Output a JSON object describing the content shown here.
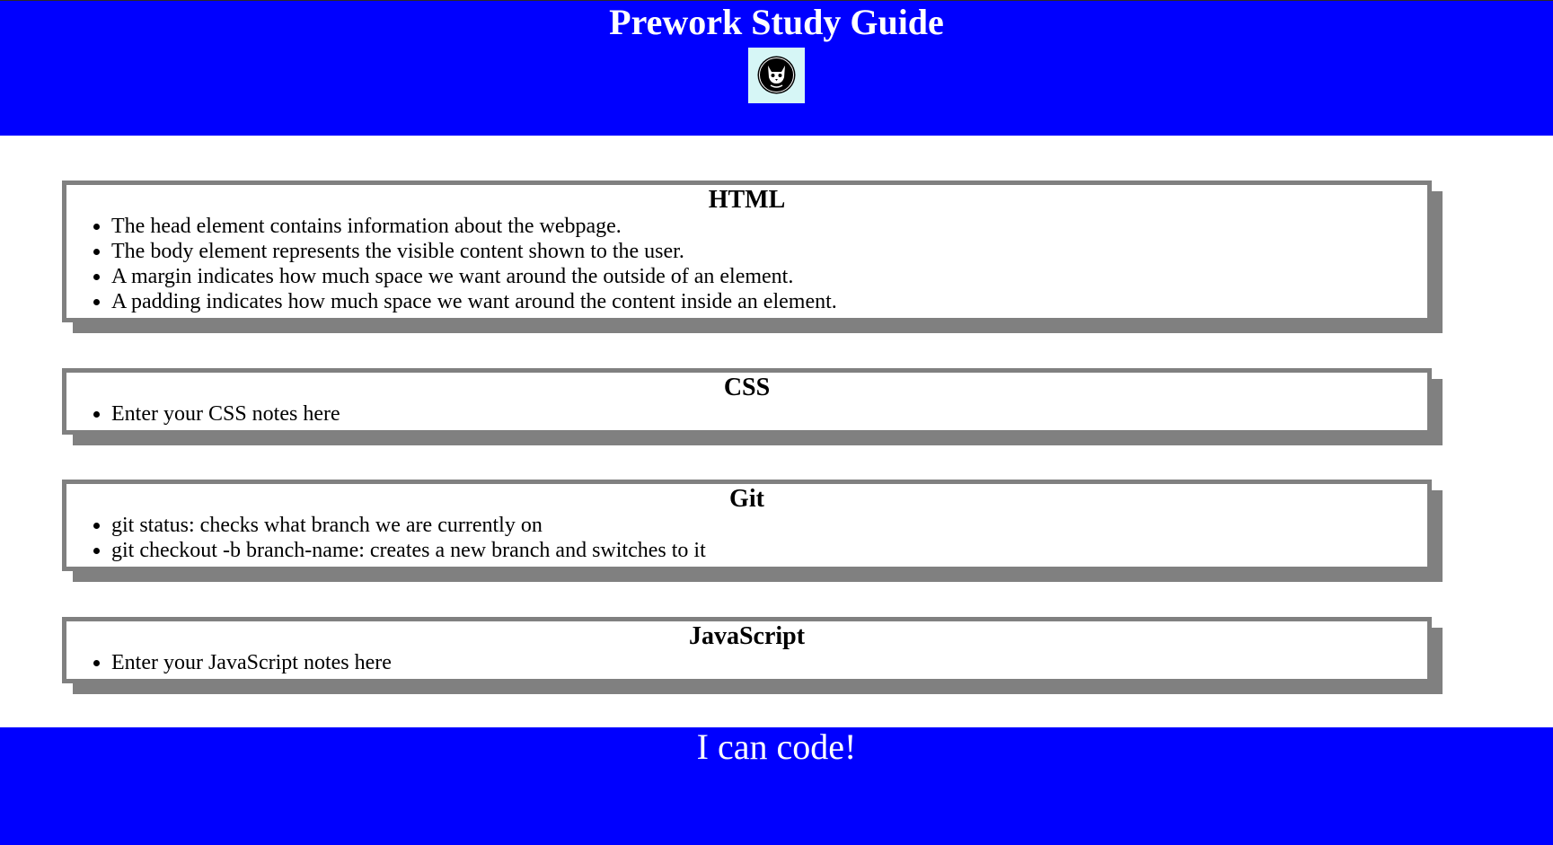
{
  "header": {
    "title": "Prework Study Guide",
    "logo_icon": "cat-face-icon"
  },
  "sections": [
    {
      "title": "HTML",
      "items": [
        "The head element contains information about the webpage.",
        "The body element represents the visible content shown to the user.",
        "A margin indicates how much space we want around the outside of an element.",
        "A padding indicates how much space we want around the content inside an element."
      ]
    },
    {
      "title": "CSS",
      "items": [
        "Enter your CSS notes here"
      ]
    },
    {
      "title": "Git",
      "items": [
        "git status: checks what branch we are currently on",
        "git checkout -b branch-name: creates a new branch and switches to it"
      ]
    },
    {
      "title": "JavaScript",
      "items": [
        "Enter your JavaScript notes here"
      ]
    }
  ],
  "footer": {
    "text": "I can code!"
  },
  "colors": {
    "banner": "#0000ff",
    "card_border": "#808080",
    "logo_background": "#d6f6f6"
  }
}
